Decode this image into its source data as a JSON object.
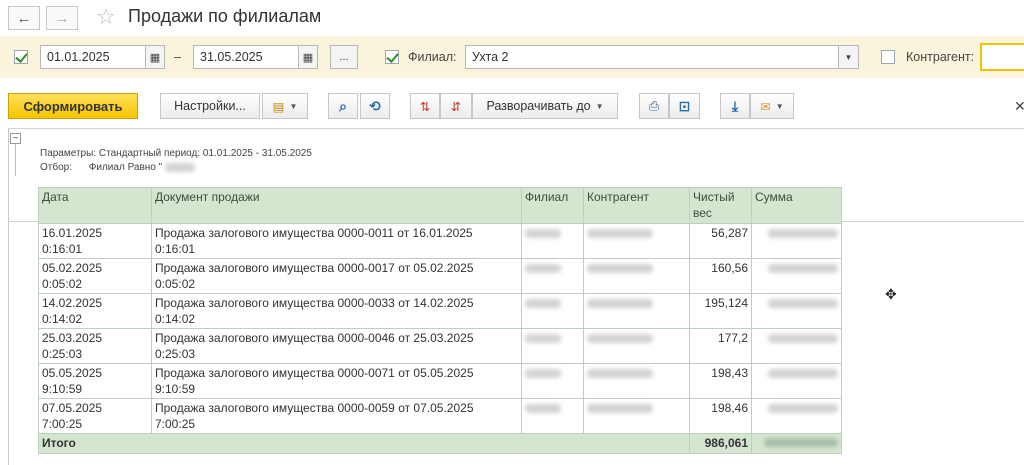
{
  "window": {
    "title": "Продажи по филиалам",
    "nav_back": "←",
    "nav_forward": "→",
    "star": "☆"
  },
  "filters": {
    "date_from": "01.01.2025",
    "date_to": "31.05.2025",
    "dash": "–",
    "more": "...",
    "branch_label": "Филиал:",
    "branch_value": "Ухта 2",
    "counterparty_label": "Контрагент:",
    "counterparty_value": ""
  },
  "toolbar": {
    "generate": "Сформировать",
    "settings": "Настройки...",
    "expand_to": "Разворачивать до"
  },
  "report": {
    "params_label": "Параметры:",
    "params_value": "Стандартный период: 01.01.2025 - 31.05.2025",
    "filter_label": "Отбор:",
    "filter_value": "Филиал Равно \"",
    "columns": [
      "Дата",
      "Документ продажи",
      "Филиал",
      "Контрагент",
      "Чистый вес",
      "Сумма"
    ],
    "rows": [
      {
        "date": "16.01.2025",
        "time": "0:16:01",
        "doc": "Продажа залогового имущества 0000-0011 от 16.01.2025",
        "doc_time": "0:16:01",
        "weight": "56,287"
      },
      {
        "date": "05.02.2025",
        "time": "0:05:02",
        "doc": "Продажа залогового имущества 0000-0017 от 05.02.2025",
        "doc_time": "0:05:02",
        "weight": "160,56"
      },
      {
        "date": "14.02.2025",
        "time": "0:14:02",
        "doc": "Продажа залогового имущества 0000-0033 от 14.02.2025",
        "doc_time": "0:14:02",
        "weight": "195,124"
      },
      {
        "date": "25.03.2025",
        "time": "0:25:03",
        "doc": "Продажа залогового имущества 0000-0046 от 25.03.2025",
        "doc_time": "0:25:03",
        "weight": "177,2"
      },
      {
        "date": "05.05.2025",
        "time": "9:10:59",
        "doc": "Продажа залогового имущества 0000-0071 от 05.05.2025",
        "doc_time": "9:10:59",
        "weight": "198,43"
      },
      {
        "date": "07.05.2025",
        "time": "7:00:25",
        "doc": "Продажа залогового имущества 0000-0059 от 07.05.2025",
        "doc_time": "7:00:25",
        "weight": "198,46"
      }
    ],
    "total_label": "Итого",
    "total_weight": "986,061"
  }
}
